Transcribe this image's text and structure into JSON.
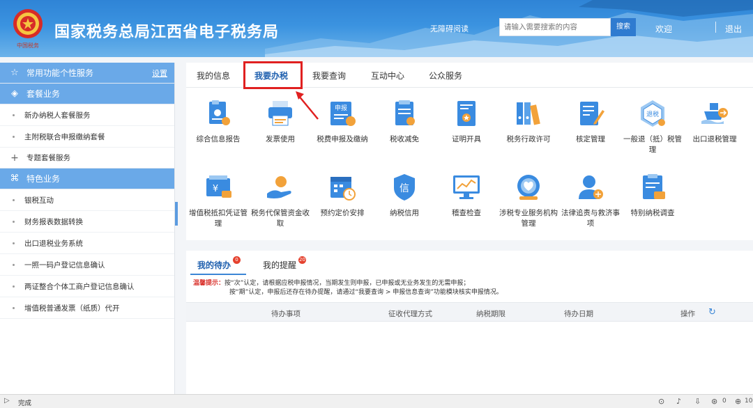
{
  "header": {
    "logo_text": "中国税务",
    "title": "国家税务总局江西省电子税务局",
    "accessible_link": "无障碍阅读",
    "search_placeholder": "请输入需要搜索的内容",
    "search_button": "搜索",
    "welcome": "欢迎",
    "logout": "退出"
  },
  "sidebar": {
    "common_services": "常用功能个性服务",
    "settings": "设置",
    "package_business": "套餐业务",
    "package_items": [
      "新办纳税人套餐服务",
      "主附税联合申报缴纳套餐"
    ],
    "special_package": "专题套餐服务",
    "featured_business": "特色业务",
    "featured_items": [
      "银税互动",
      "财务报表数据转换",
      "出口退税业务系统",
      "一照一码户登记信息确认",
      "两证整合个体工商户登记信息确认",
      "增值税普通发票（纸质）代开"
    ]
  },
  "tabs": [
    "我的信息",
    "我要办税",
    "我要查询",
    "互动中心",
    "公众服务"
  ],
  "active_tab": "我要办税",
  "functions_row1": [
    {
      "label": "综合信息报告",
      "icon": "report-icon"
    },
    {
      "label": "发票使用",
      "icon": "printer-icon"
    },
    {
      "label": "税费申报及缴纳",
      "icon": "declaration-icon",
      "icon_text": "申报"
    },
    {
      "label": "税收减免",
      "icon": "tax-relief-icon"
    },
    {
      "label": "证明开具",
      "icon": "certificate-icon"
    },
    {
      "label": "税务行政许可",
      "icon": "binders-icon"
    },
    {
      "label": "核定管理",
      "icon": "edit-doc-icon"
    },
    {
      "label": "一般退（抵）税管理",
      "icon": "refund-icon",
      "icon_text": "退税"
    },
    {
      "label": "出口退税管理",
      "icon": "ship-icon"
    }
  ],
  "functions_row2": [
    {
      "label": "增值税抵扣凭证管理",
      "icon": "vat-deduction-icon",
      "icon_text": "¥"
    },
    {
      "label": "税务代保管资金收取",
      "icon": "hand-money-icon"
    },
    {
      "label": "预约定价安排",
      "icon": "calendar-clock-icon"
    },
    {
      "label": "纳税信用",
      "icon": "credit-shield-icon",
      "icon_text": "信"
    },
    {
      "label": "稽查检查",
      "icon": "monitor-chart-icon"
    },
    {
      "label": "涉税专业服务机构管理",
      "icon": "agency-icon"
    },
    {
      "label": "法律追责与救济事项",
      "icon": "legal-icon"
    },
    {
      "label": "特别纳税调查",
      "icon": "investigation-icon"
    }
  ],
  "todo": {
    "tab_todo": "我的待办",
    "todo_badge": "0",
    "tab_reminder": "我的提醒",
    "reminder_badge": "20",
    "tip_label": "温馨提示：",
    "tip_line1": "按“次”认定，请根据应税申报情况，当期发生则申报，已申报或无业务发生的无需申报；",
    "tip_line2": "按“期”认定，申报后还存在待办提醒，请通过“我要查询 > 申报信息查询”功能模块核实申报情况。",
    "columns": [
      "待办事项",
      "征收代理方式",
      "纳税期限",
      "待办日期",
      "操作"
    ]
  },
  "statusbar": {
    "status": "完成",
    "zoom": "10"
  },
  "colors": {
    "header_blue": "#3b93e0",
    "sidebar_blue": "#6aa9e8",
    "icon_blue": "#3a8be0",
    "icon_orange": "#f2a23a",
    "highlight_red": "#e02020"
  }
}
